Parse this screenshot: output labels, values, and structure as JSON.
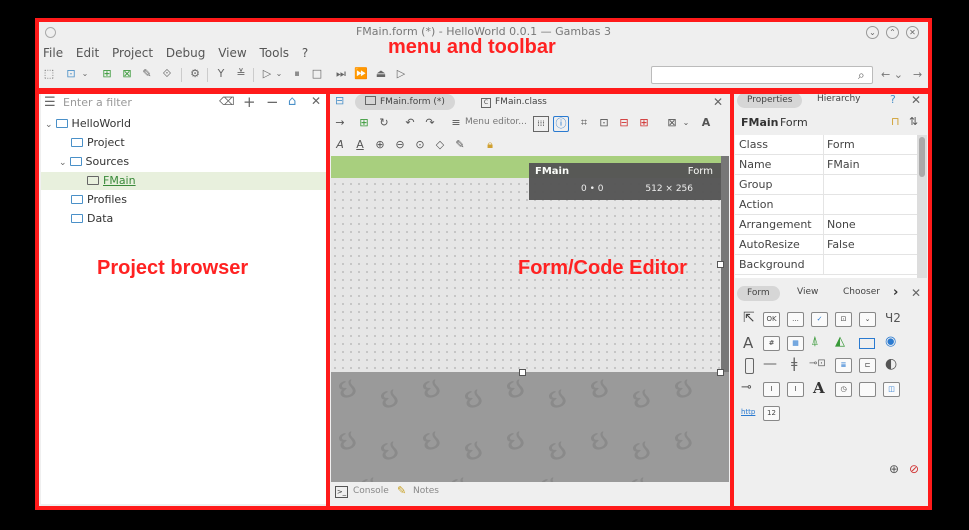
{
  "window": {
    "title": "FMain.form (*) - HelloWorld 0.0.1 — Gambas 3"
  },
  "menu": [
    "File",
    "Edit",
    "Project",
    "Debug",
    "View",
    "Tools",
    "?"
  ],
  "annotations": {
    "menu_toolbar": "menu and toolbar",
    "project_browser": "Project browser",
    "form_editor": "Form/Code Editor"
  },
  "project": {
    "filter_placeholder": "Enter a filter",
    "tree": [
      {
        "label": "HelloWorld"
      },
      {
        "label": "Project"
      },
      {
        "label": "Sources"
      },
      {
        "label": "FMain"
      },
      {
        "label": "Profiles"
      },
      {
        "label": "Data"
      }
    ]
  },
  "editor": {
    "tabs": [
      {
        "label": "FMain.form (*)"
      },
      {
        "label": "FMain.class"
      }
    ],
    "menu_editor": "Menu editor...",
    "form_info": {
      "name": "FMain",
      "class": "Form",
      "position": "0 • 0",
      "size": "512 × 256"
    }
  },
  "bottom": {
    "console": "Console",
    "notes": "Notes"
  },
  "properties": {
    "tabs": [
      "Properties",
      "Hierarchy",
      "?"
    ],
    "header_name": "FMain",
    "header_class": "Form",
    "rows": [
      {
        "key": "Class",
        "value": "Form"
      },
      {
        "key": "Name",
        "value": "FMain"
      },
      {
        "key": "Group",
        "value": ""
      },
      {
        "key": "Action",
        "value": ""
      },
      {
        "key": "Arrangement",
        "value": "None"
      },
      {
        "key": "AutoResize",
        "value": "False"
      },
      {
        "key": "Background",
        "value": ""
      }
    ]
  },
  "toolbox": {
    "tabs": [
      "Form",
      "View",
      "Chooser"
    ],
    "tools": [
      "OK",
      "...",
      "12",
      "http",
      "#",
      "A"
    ]
  }
}
